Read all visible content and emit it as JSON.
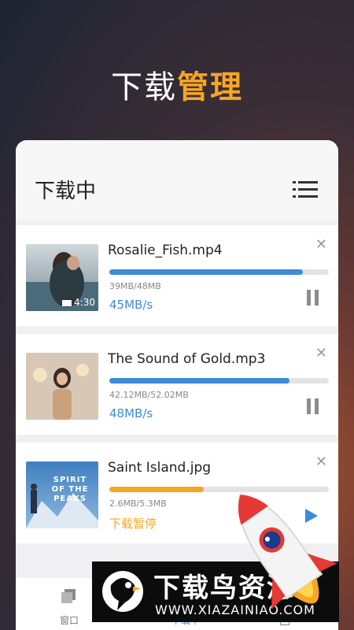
{
  "headline": {
    "part1": "下载",
    "part2": "管理"
  },
  "panel": {
    "title": "下载中",
    "menu_icon": "list-icon"
  },
  "downloads": [
    {
      "name": "Rosalie_Fish.mp4",
      "size": "39MB/48MB",
      "status": "45MB/s",
      "progress": 0.88,
      "bar_color": "#3d8bd9",
      "state": "downloading",
      "duration": "4:30"
    },
    {
      "name": "The Sound of Gold.mp3",
      "size": "42.12MB/52.02MB",
      "status": "48MB/s",
      "progress": 0.82,
      "bar_color": "#3d8bd9",
      "state": "downloading"
    },
    {
      "name": "Saint Island.jpg",
      "size": "2.6MB/5.3MB",
      "status": "下载暂停",
      "progress": 0.43,
      "bar_color": "#f5a623",
      "state": "paused",
      "thumb_text": "SPIRIT OF THE PEAKS"
    }
  ],
  "bottom_tabs": [
    {
      "label": "窗口",
      "icon": "window-icon"
    },
    {
      "label": "下载中",
      "icon": "download-icon"
    },
    {
      "label": "",
      "icon": "file-icon"
    }
  ],
  "watermark": {
    "name": "下载鸟资源",
    "url": "WWW.XIAZAINIAO.COM"
  },
  "colors": {
    "accent": "#f5a623",
    "progress_blue": "#3d8bd9",
    "paused_orange": "#f5a623"
  }
}
